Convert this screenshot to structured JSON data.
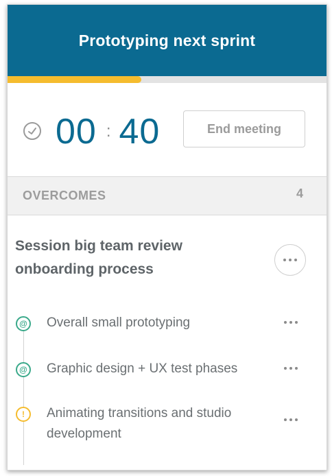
{
  "header": {
    "title": "Prototyping next sprint",
    "bg_color": "#0b6a91"
  },
  "progress": {
    "fraction": 0.42,
    "color": "#f5bc2e"
  },
  "timer": {
    "minutes": "00",
    "separator": ":",
    "seconds": "40",
    "icon": "clock-icon"
  },
  "end_button": {
    "label": "End meeting"
  },
  "section": {
    "title": "OVERCOMES",
    "count": "4"
  },
  "topic": {
    "title": "Session big team review onboarding process",
    "menu_icon": "more-horizontal-icon"
  },
  "items": [
    {
      "text": "Overall small prototyping",
      "icon": "mention-icon",
      "glyph": "@",
      "color": "#3aa98a"
    },
    {
      "text": "Graphic design + UX test phases",
      "icon": "mention-icon",
      "glyph": "@",
      "color": "#3aa98a"
    },
    {
      "text": "Animating transitions and studio development",
      "icon": "alert-icon",
      "glyph": "!",
      "color": "#f5bc2e"
    }
  ]
}
